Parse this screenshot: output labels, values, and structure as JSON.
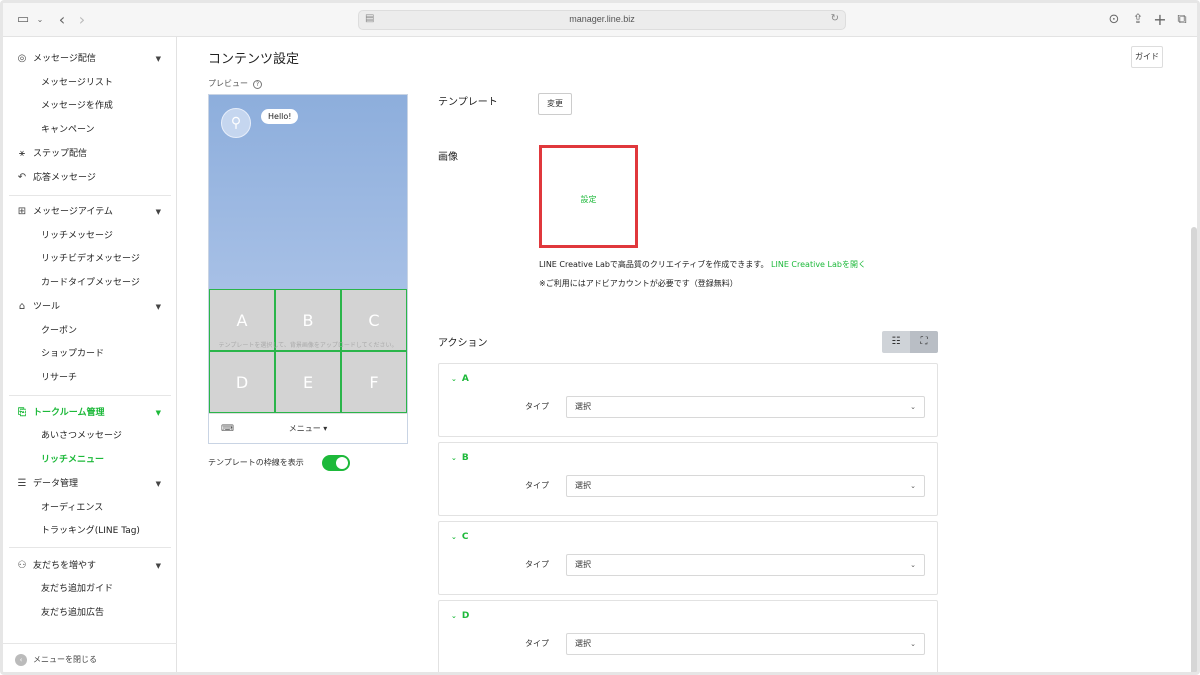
{
  "browser": {
    "url": "manager.line.biz",
    "icons": [
      "sidebar-icon",
      "chevron-down-icon",
      "back-icon",
      "forward-icon",
      "download-icon",
      "share-icon",
      "plus-icon",
      "tabs-icon"
    ]
  },
  "sidebar": {
    "groups": [
      {
        "label": "メッセージ配信",
        "icon": "broadcast-icon",
        "items": [
          "メッセージリスト",
          "メッセージを作成",
          "キャンペーン"
        ]
      },
      {
        "label": "ステップ配信",
        "icon": "step-icon"
      },
      {
        "label": "応答メッセージ",
        "icon": "reply-icon"
      },
      {
        "label": "メッセージアイテム",
        "icon": "add-box-icon",
        "items": [
          "リッチメッセージ",
          "リッチビデオメッセージ",
          "カードタイプメッセージ"
        ]
      },
      {
        "label": "ツール",
        "icon": "shop-icon",
        "items": [
          "クーポン",
          "ショップカード",
          "リサーチ"
        ]
      },
      {
        "label": "トークルーム管理",
        "icon": "chat-icon",
        "active": true,
        "items": [
          "あいさつメッセージ",
          "リッチメニュー"
        ]
      },
      {
        "label": "データ管理",
        "icon": "database-icon",
        "items": [
          "オーディエンス",
          "トラッキング(LINE Tag)"
        ]
      },
      {
        "label": "友だちを増やす",
        "icon": "add-friend-icon",
        "items": [
          "友だち追加ガイド",
          "友だち追加広告"
        ]
      }
    ],
    "close_label": "メニューを閉じる"
  },
  "main": {
    "title": "コンテンツ設定",
    "guide_label": "ガイド",
    "preview_label": "プレビュー",
    "preview": {
      "bubble": "Hello!",
      "cells": [
        "A",
        "B",
        "C",
        "D",
        "E",
        "F"
      ],
      "hint": "テンプレートを選択して、背景画像をアップロードしてください。",
      "menu_label": "メニュー ▾"
    },
    "toggle_label": "テンプレートの枠線を表示",
    "toggle_on": true,
    "template_label": "テンプレート",
    "change_label": "変更",
    "image_label": "画像",
    "set_label": "設定",
    "lab_text": "LINE Creative Labで高品質のクリエイティブを作成できます。",
    "lab_link": "LINE Creative Labを開く",
    "lab_note": "※ご利用にはアドビアカウントが必要です（登録無料）",
    "action_label": "アクション",
    "actions": [
      {
        "letter": "A",
        "type_label": "タイプ",
        "value": "選択"
      },
      {
        "letter": "B",
        "type_label": "タイプ",
        "value": "選択"
      },
      {
        "letter": "C",
        "type_label": "タイプ",
        "value": "選択"
      },
      {
        "letter": "D",
        "type_label": "タイプ",
        "value": "選択"
      }
    ]
  },
  "colors": {
    "accent": "#1db93a",
    "highlight": "#e0383c"
  }
}
